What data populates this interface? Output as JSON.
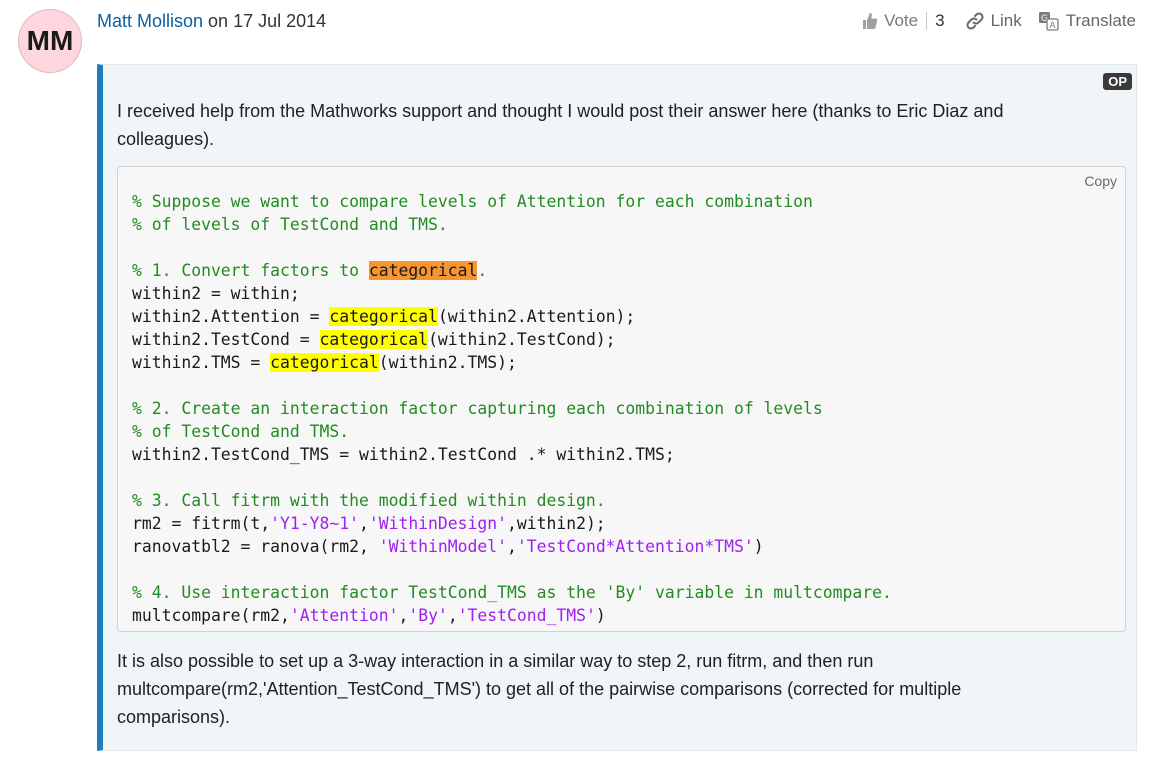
{
  "post": {
    "avatar_initials": "MM",
    "author": "Matt Mollison",
    "date_prefix": " on ",
    "date": "17 Jul 2014"
  },
  "actions": {
    "vote_label": "Vote",
    "vote_count": "3",
    "link_label": "Link",
    "translate_label": "Translate"
  },
  "answer": {
    "badge": "OP",
    "intro": "I received help from the Mathworks support and thought I would post their answer here (thanks to Eric Diaz and colleagues).",
    "copy_label": "Copy",
    "outro": "It is also possible to set up a 3-way interaction in a similar way to step 2, run fitrm, and then run multcompare(rm2,'Attention_TestCond_TMS') to get all of the pairwise comparisons (corrected for multiple comparisons)."
  },
  "code_lines": [
    [
      {
        "t": "% Suppose we want to compare levels of Attention for each combination",
        "c": "cm"
      }
    ],
    [
      {
        "t": "% of levels of TestCond and TMS.",
        "c": "cm"
      }
    ],
    [],
    [
      {
        "t": "% 1. Convert factors to ",
        "c": "cm"
      },
      {
        "t": "categorical",
        "c": "hl-o"
      },
      {
        "t": ".",
        "c": "cm"
      }
    ],
    [
      {
        "t": "within2 = within;"
      }
    ],
    [
      {
        "t": "within2.Attention = "
      },
      {
        "t": "categorical",
        "c": "hl-y"
      },
      {
        "t": "(within2.Attention);"
      }
    ],
    [
      {
        "t": "within2.TestCond = "
      },
      {
        "t": "categorical",
        "c": "hl-y"
      },
      {
        "t": "(within2.TestCond);"
      }
    ],
    [
      {
        "t": "within2.TMS = "
      },
      {
        "t": "categorical",
        "c": "hl-y"
      },
      {
        "t": "(within2.TMS);"
      }
    ],
    [],
    [
      {
        "t": "% 2. Create an interaction factor capturing each combination of levels",
        "c": "cm"
      }
    ],
    [
      {
        "t": "% of TestCond and TMS.",
        "c": "cm"
      }
    ],
    [
      {
        "t": "within2.TestCond_TMS = within2.TestCond .* within2.TMS;"
      }
    ],
    [],
    [
      {
        "t": "% 3. Call fitrm with the modified within design.",
        "c": "cm"
      }
    ],
    [
      {
        "t": "rm2 = fitrm(t,"
      },
      {
        "t": "'Y1-Y8~1'",
        "c": "st"
      },
      {
        "t": ","
      },
      {
        "t": "'WithinDesign'",
        "c": "st"
      },
      {
        "t": ",within2);"
      }
    ],
    [
      {
        "t": "ranovatbl2 = ranova(rm2, "
      },
      {
        "t": "'WithinModel'",
        "c": "st"
      },
      {
        "t": ","
      },
      {
        "t": "'TestCond*Attention*TMS'",
        "c": "st"
      },
      {
        "t": ")"
      }
    ],
    [],
    [
      {
        "t": "% 4. Use interaction factor TestCond_TMS as the 'By' variable in multcompare.",
        "c": "cm"
      }
    ],
    [
      {
        "t": "multcompare(rm2,"
      },
      {
        "t": "'Attention'",
        "c": "st"
      },
      {
        "t": ","
      },
      {
        "t": "'By'",
        "c": "st"
      },
      {
        "t": ","
      },
      {
        "t": "'TestCond_TMS'",
        "c": "st"
      },
      {
        "t": ")"
      }
    ]
  ]
}
